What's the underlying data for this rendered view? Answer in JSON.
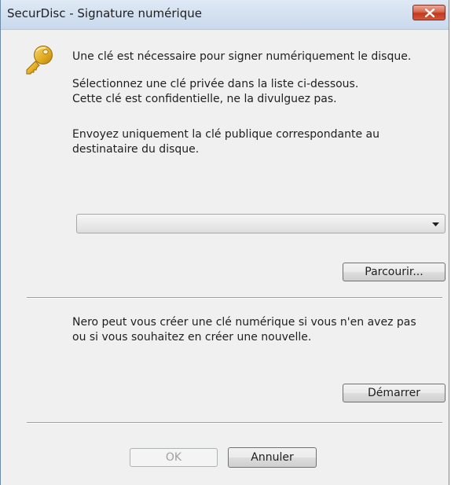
{
  "window": {
    "title": "SecurDisc - Signature numérique"
  },
  "dialog": {
    "line1": "Une clé est nécessaire pour signer numériquement le disque.",
    "line2": "Sélectionnez une clé privée dans la liste ci-dessous.",
    "line3": "Cette clé est confidentielle, ne la divulguez pas.",
    "line4": "Envoyez uniquement la clé publique correspondante au",
    "line5": "destinataire du disque.",
    "key_select_value": "",
    "browse_label": "Parcourir...",
    "nero_line1": "Nero peut vous créer une clé numérique si vous n'en avez pas",
    "nero_line2": "ou si vous souhaitez en créer une nouvelle.",
    "start_label": "Démarrer",
    "ok_label": "OK",
    "cancel_label": "Annuler"
  },
  "icons": {
    "key": "key-icon",
    "close": "close-icon",
    "dropdown": "chevron-down-icon"
  },
  "colors": {
    "close_button": "#c1391d",
    "key_gold": "#e8b72e",
    "titlebar": "#dfe9f5"
  }
}
